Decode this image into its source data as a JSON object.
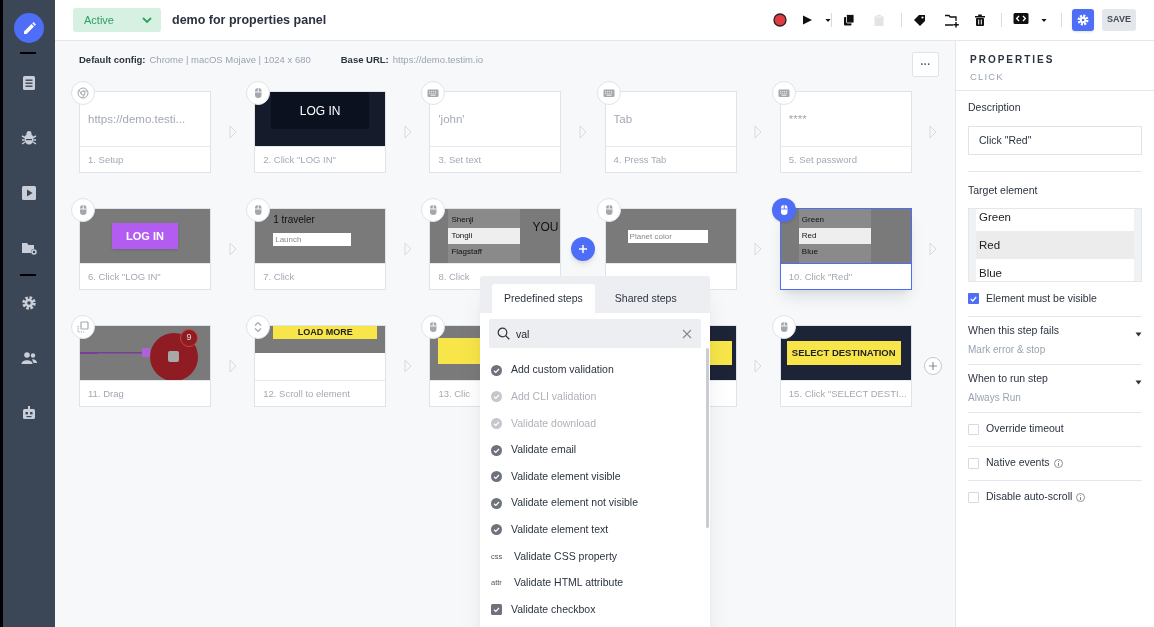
{
  "sidebar": {
    "items": [
      {
        "selected": true
      },
      {
        "selected": false
      },
      {
        "selected": false
      },
      {
        "selected": false
      },
      {
        "selected": false
      },
      {
        "selected": false
      },
      {
        "selected": false
      },
      {
        "selected": false
      }
    ]
  },
  "header": {
    "status": "Active",
    "title": "demo for properties panel"
  },
  "toolbar": {
    "buttons": [
      {
        "disabled": false
      },
      {
        "disabled": false
      },
      {
        "disabled": false
      },
      {
        "disabled": true
      },
      {
        "disabled": false
      },
      {
        "disabled": false
      },
      {
        "disabled": false
      },
      {
        "disabled": false
      }
    ],
    "settings_selected": true,
    "save_label": "SAVE"
  },
  "config": {
    "default_config_label": "Default config:",
    "default_config": "Chrome | macOS Mojave | 1024 x 680",
    "base_url_label": "Base URL:",
    "base_url": "https://demo.testim.io",
    "more_label": "···"
  },
  "rows": [
    {
      "steps": [
        {
          "kind": "setup",
          "selected": false,
          "thumbnail": {
            "kind": "text",
            "text": "https://demo.testi..."
          },
          "label": "1. Setup"
        },
        {
          "kind": "click",
          "selected": false,
          "thumbnail": {
            "kind": "dark-button",
            "text": "LOG IN"
          },
          "label": "2. Click \"LOG IN\""
        },
        {
          "kind": "text",
          "selected": false,
          "thumbnail": {
            "kind": "text",
            "text": "'john'"
          },
          "label": "3. Set text"
        },
        {
          "kind": "text",
          "selected": false,
          "thumbnail": {
            "kind": "text",
            "text": "Tab"
          },
          "label": "4. Press Tab"
        },
        {
          "kind": "text",
          "selected": false,
          "thumbnail": {
            "kind": "text",
            "text": "****"
          },
          "label": "5. Set password"
        }
      ],
      "connectors": [
        {
          "kind": "arrow"
        },
        {
          "kind": "arrow"
        },
        {
          "kind": "arrow"
        },
        {
          "kind": "arrow"
        },
        {
          "kind": "arrow"
        }
      ]
    },
    {
      "steps": [
        {
          "kind": "click",
          "selected": false,
          "thumbnail": {
            "kind": "purple-button",
            "text": "LOG IN"
          },
          "label": "6. Click \"LOG IN\""
        },
        {
          "kind": "click",
          "selected": false,
          "thumbnail": {
            "kind": "form",
            "heading": "1 traveler",
            "placeholder": "Launch"
          },
          "label": "7. Click"
        },
        {
          "kind": "click",
          "selected": false,
          "thumbnail": {
            "kind": "list",
            "options": [
              {
                "label": "Shenji",
                "selected": false
              },
              {
                "label": "Tongli",
                "selected": true
              },
              {
                "label": "Flagstaff",
                "selected": false
              }
            ],
            "side": "YOU"
          },
          "label": "8. Click"
        },
        {
          "kind": "click",
          "selected": false,
          "thumbnail": {
            "kind": "select",
            "placeholder": "Planet color"
          }
        },
        {
          "kind": "click",
          "selected": true,
          "thumbnail": {
            "kind": "list",
            "options": [
              {
                "label": "Green",
                "selected": false
              },
              {
                "label": "Red",
                "selected": true
              },
              {
                "label": "Blue",
                "selected": false
              }
            ]
          },
          "label": "10. Click \"Red\""
        }
      ],
      "connectors": [
        {
          "kind": "arrow"
        },
        {
          "kind": "arrow"
        },
        {
          "kind": "add"
        },
        {
          "kind": "arrow"
        },
        {
          "kind": "arrow"
        }
      ]
    },
    {
      "steps": [
        {
          "kind": "drag",
          "selected": false,
          "thumbnail": {
            "kind": "drag",
            "badge": "9"
          },
          "label": "11. Drag"
        },
        {
          "kind": "scroll",
          "selected": false,
          "thumbnail": {
            "kind": "yellow-button",
            "text": "LOAD MORE"
          },
          "label": "12. Scroll to element"
        },
        {
          "kind": "click",
          "selected": false,
          "thumbnail": {
            "kind": "yellow-block"
          },
          "label": "13. Clic"
        },
        {
          "selected": false,
          "thumbnail": {
            "kind": "navy-yellow"
          }
        },
        {
          "kind": "click",
          "selected": false,
          "thumbnail": {
            "kind": "navy-yellow",
            "text": "SELECT DESTINATION"
          },
          "label": "15. Click \"SELECT DESTI..."
        }
      ],
      "connectors": [
        {
          "kind": "arrow"
        },
        {
          "kind": "arrow"
        },
        {
          "kind": "blank"
        },
        {
          "kind": "arrow"
        },
        {
          "kind": "plus"
        }
      ]
    }
  ],
  "step_picker": {
    "tabs": [
      {
        "label": "Predefined steps",
        "selected": true
      },
      {
        "label": "Shared steps",
        "selected": false
      }
    ],
    "search": {
      "value": "val"
    },
    "items": [
      {
        "kind": "check",
        "label": "Add custom validation",
        "disabled": false
      },
      {
        "kind": "check",
        "label": "Add CLI validation",
        "disabled": true
      },
      {
        "kind": "check",
        "label": "Validate download",
        "disabled": true
      },
      {
        "kind": "check",
        "label": "Validate email",
        "disabled": false
      },
      {
        "kind": "check",
        "label": "Validate element visible",
        "disabled": false
      },
      {
        "kind": "check",
        "label": "Validate element not visible",
        "disabled": false
      },
      {
        "kind": "check",
        "label": "Validate element text",
        "disabled": false
      },
      {
        "kind": "code",
        "badge": "css",
        "label": "Validate CSS property",
        "disabled": false
      },
      {
        "kind": "code",
        "badge": "attr",
        "label": "Validate HTML attribute",
        "disabled": false
      },
      {
        "kind": "checkbox",
        "label": "Validate checkbox",
        "disabled": false
      }
    ]
  },
  "properties": {
    "title": "PROPERTIES",
    "subtitle": "CLICK",
    "description_label": "Description",
    "description": "Click \"Red\"",
    "target_label": "Target element",
    "target_options": [
      {
        "label": "Green",
        "selected": false
      },
      {
        "label": "Red",
        "selected": true
      },
      {
        "label": "Blue",
        "selected": false
      }
    ],
    "settings": [
      {
        "kind": "checkbox",
        "label": "Element must be visible",
        "checked": true
      },
      {
        "kind": "dropdown",
        "label": "When this step fails",
        "value": "Mark error & stop"
      },
      {
        "kind": "dropdown",
        "label": "When to run step",
        "value": "Always Run"
      },
      {
        "kind": "checkbox",
        "label": "Override timeout",
        "checked": false
      },
      {
        "kind": "checkbox",
        "label": "Native events",
        "checked": false,
        "info": true
      },
      {
        "kind": "checkbox",
        "label": "Disable auto-scroll",
        "checked": false,
        "info": true
      }
    ]
  }
}
